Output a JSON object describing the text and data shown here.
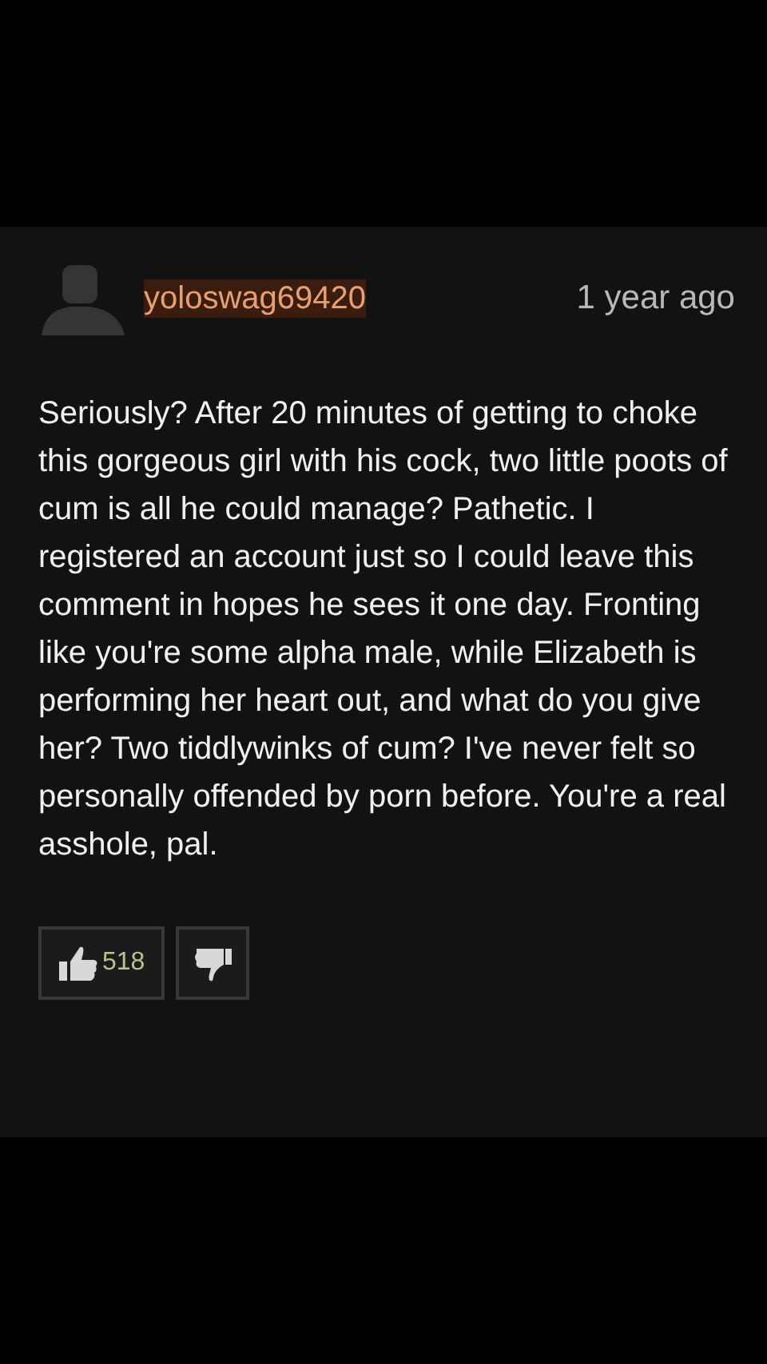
{
  "comment": {
    "username": "yoloswag69420",
    "time": "1 year ago",
    "text": "Seriously? After 20 minutes of getting to choke this gorgeous girl with his cock, two little poots of cum is all he could manage? Pathetic. I registered an account just so I could leave this comment in hopes he sees it one day. Fronting like you're some alpha male, while Elizabeth is performing her heart out, and what do you give her? Two tiddlywinks of cum? I've never felt so personally offended by porn before. You're a real asshole, pal.",
    "likes": "518"
  }
}
